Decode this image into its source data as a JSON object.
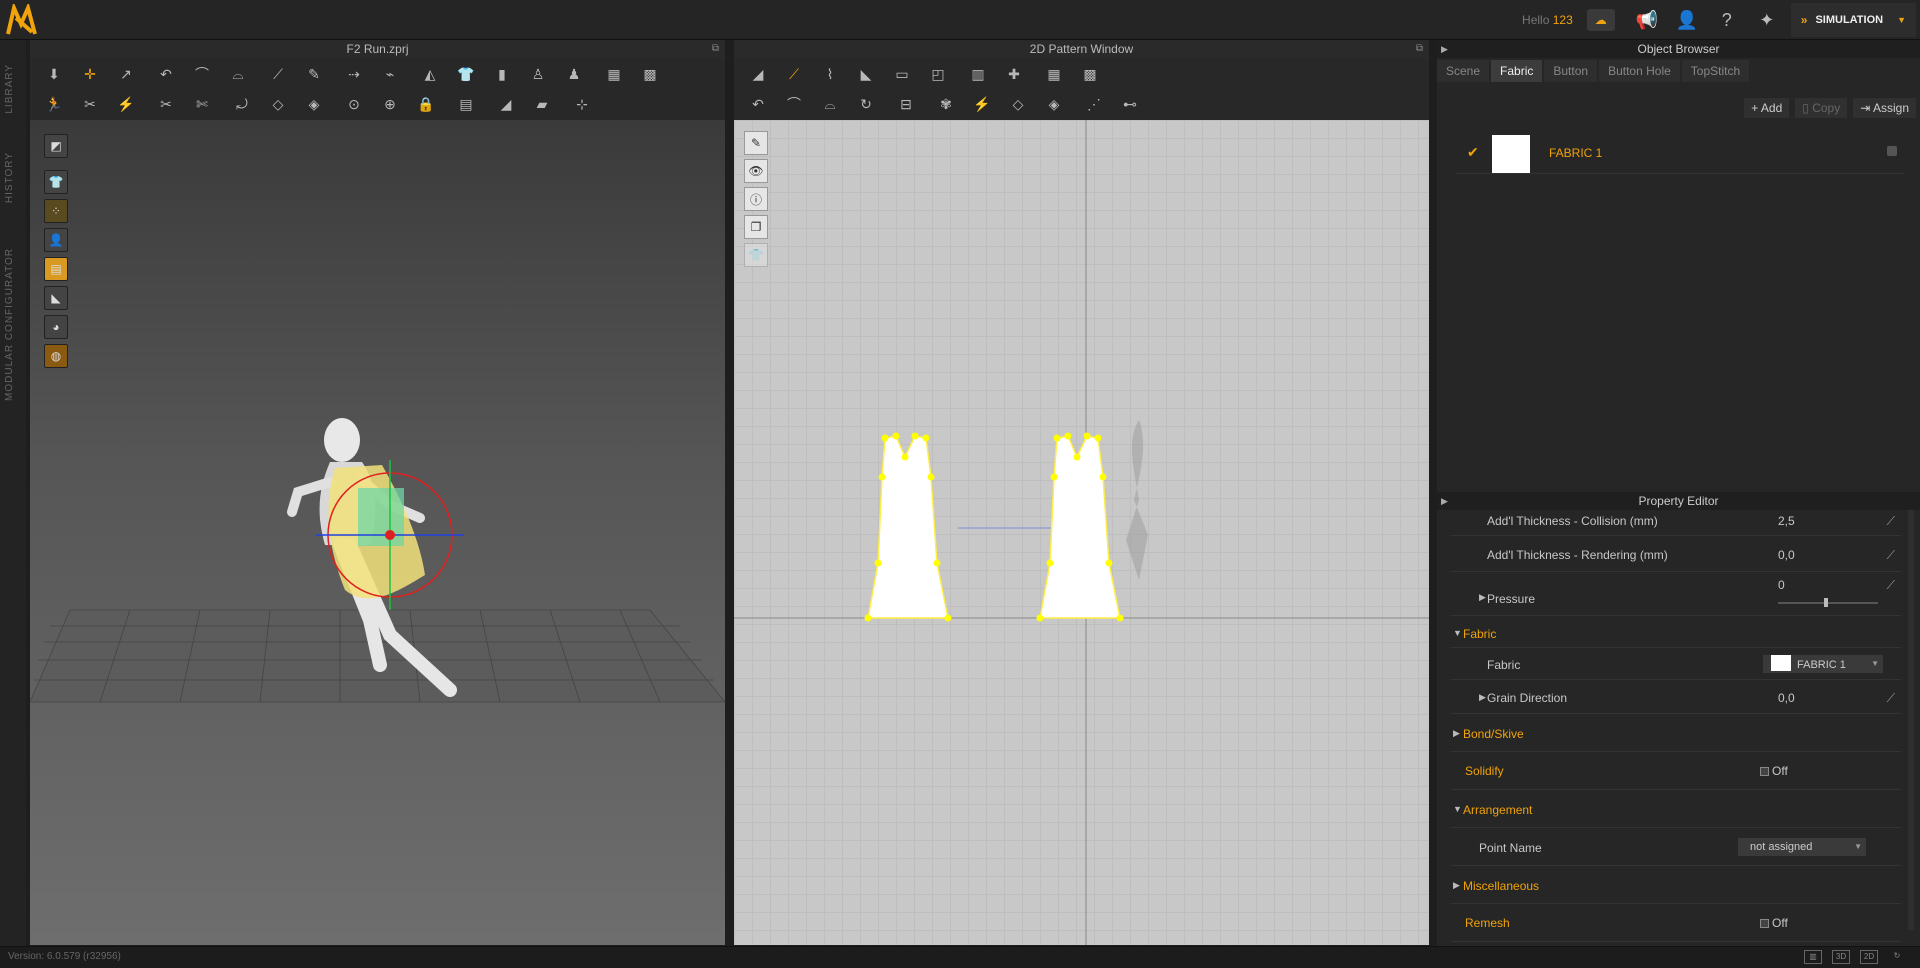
{
  "app": {
    "greeting": "Hello",
    "username": "123",
    "mode": "SIMULATION",
    "version": "Version: 6.0.579 (r32956)"
  },
  "left_tabs": [
    "LIBRARY",
    "HISTORY",
    "MODULAR CONFIGURATOR"
  ],
  "viewport3d": {
    "title": "F2 Run.zprj"
  },
  "viewport2d": {
    "title": "2D Pattern Window"
  },
  "object_browser": {
    "title": "Object Browser",
    "tabs": [
      "Scene",
      "Fabric",
      "Button",
      "Button Hole",
      "TopStitch"
    ],
    "actions": {
      "add": "Add",
      "copy": "Copy",
      "assign": "Assign"
    },
    "fabrics": [
      {
        "name": "FABRIC 1",
        "swatch": "#ffffff"
      }
    ]
  },
  "property_editor": {
    "title": "Property Editor",
    "rows": {
      "thick_collision": {
        "label": "Add'l Thickness - Collision (mm)",
        "value": "2,5"
      },
      "thick_render": {
        "label": "Add'l Thickness - Rendering (mm)",
        "value": "0,0"
      },
      "pressure": {
        "label": "Pressure",
        "value": "0"
      },
      "fabric_section": "Fabric",
      "fabric": {
        "label": "Fabric",
        "value": "FABRIC 1"
      },
      "grain": {
        "label": "Grain Direction",
        "value": "0,0"
      },
      "bond": "Bond/Skive",
      "solidify": {
        "label": "Solidify",
        "value": "Off"
      },
      "arrangement": "Arrangement",
      "point_name": {
        "label": "Point Name",
        "value": "not assigned"
      },
      "misc": "Miscellaneous",
      "remesh": {
        "label": "Remesh",
        "value": "Off"
      }
    }
  },
  "colors": {
    "accent": "#f0a30a",
    "pattern_point": "#ffff00"
  }
}
